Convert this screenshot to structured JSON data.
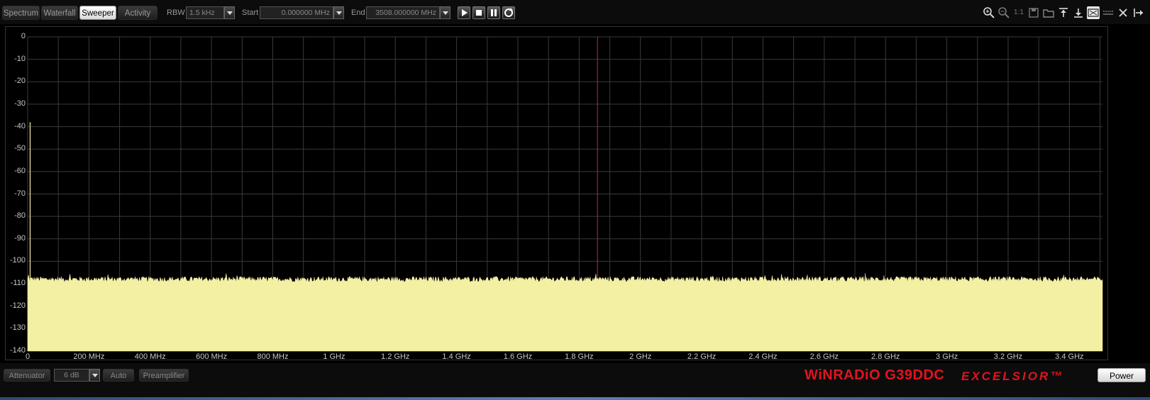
{
  "toolbar": {
    "tabs": [
      {
        "label": "Spectrum",
        "active": false
      },
      {
        "label": "Waterfall",
        "active": false
      },
      {
        "label": "Sweeper",
        "active": true
      },
      {
        "label": "Activity",
        "active": false
      }
    ],
    "rbw_label": "RBW",
    "rbw_value": "1.5 kHz",
    "start_label": "Start",
    "start_value": "0.000000 MHz",
    "end_label": "End",
    "end_value": "3508.000000 MHz",
    "playback_icons": [
      "play-icon",
      "stop-icon",
      "pause-icon",
      "refresh-icon"
    ],
    "right_icons": [
      "zoom-in-icon",
      "zoom-out-icon",
      "zoom-1to1-icon",
      "save-icon",
      "open-folder-icon",
      "move-top-icon",
      "move-bottom-icon",
      "clear-icon",
      "line-style-icon",
      "close-icon",
      "dock-icon"
    ],
    "zoom_1to1_label": "1:1"
  },
  "chart_data": {
    "type": "area",
    "title": "",
    "xlabel": "",
    "ylabel": "",
    "x_range_mhz": [
      0,
      3508
    ],
    "ylim": [
      -140,
      0
    ],
    "y_ticks": [
      0,
      -10,
      -20,
      -30,
      -40,
      -50,
      -60,
      -70,
      -80,
      -90,
      -100,
      -110,
      -120,
      -130,
      -140
    ],
    "x_ticks": [
      {
        "value": 0,
        "label": "0"
      },
      {
        "value": 200,
        "label": "200 MHz"
      },
      {
        "value": 400,
        "label": "400 MHz"
      },
      {
        "value": 600,
        "label": "600 MHz"
      },
      {
        "value": 800,
        "label": "800 MHz"
      },
      {
        "value": 1000,
        "label": "1 GHz"
      },
      {
        "value": 1200,
        "label": "1.2 GHz"
      },
      {
        "value": 1400,
        "label": "1.4 GHz"
      },
      {
        "value": 1600,
        "label": "1.6 GHz"
      },
      {
        "value": 1800,
        "label": "1.8 GHz"
      },
      {
        "value": 2000,
        "label": "2 GHz"
      },
      {
        "value": 2200,
        "label": "2.2 GHz"
      },
      {
        "value": 2400,
        "label": "2.4 GHz"
      },
      {
        "value": 2600,
        "label": "2.6 GHz"
      },
      {
        "value": 2800,
        "label": "2.8 GHz"
      },
      {
        "value": 3000,
        "label": "3 GHz"
      },
      {
        "value": 3200,
        "label": "3.2 GHz"
      },
      {
        "value": 3400,
        "label": "3.4 GHz"
      }
    ],
    "vertical_grid_mhz": [
      0,
      100,
      200,
      300,
      400,
      500,
      600,
      700,
      800,
      900,
      1000,
      1100,
      1200,
      1300,
      1400,
      1500,
      1600,
      1700,
      1800,
      1900,
      2000,
      2100,
      2200,
      2300,
      2400,
      2500,
      2600,
      2700,
      2800,
      2900,
      3000,
      3100,
      3200,
      3300,
      3400,
      3500
    ],
    "grid": true,
    "noise_floor_db": -108,
    "noise_jitter_db": 1.2,
    "peak": {
      "x_mhz": 8,
      "y_db": -38
    },
    "marker_x_mhz": 1860,
    "fill_color": "#f3efa3",
    "marker_color": "#b01e1e",
    "grid_color": "#3a3a3a"
  },
  "bottom": {
    "attenuator_label": "Attenuator",
    "attenuator_value": "6 dB",
    "auto_label": "Auto",
    "preamp_label": "Preamplifier",
    "brand": "WiNRADiO G39DDC",
    "brand_sub": "EXCELSIOR™",
    "power_label": "Power"
  },
  "colors": {
    "background": "#000000",
    "brand": "#e1141e"
  }
}
